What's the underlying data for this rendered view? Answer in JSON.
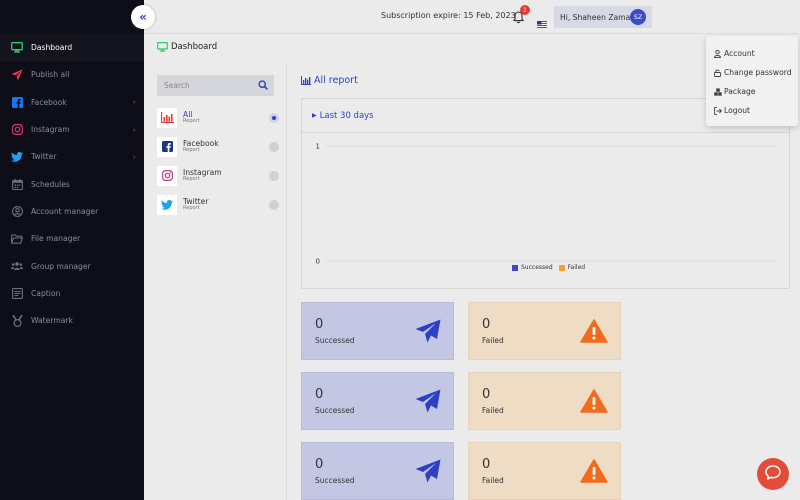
{
  "sidebar": {
    "items": [
      {
        "label": "Dashboard",
        "icon": "monitor-icon",
        "active": true
      },
      {
        "label": "Publish all",
        "icon": "paper-plane-icon"
      },
      {
        "label": "Facebook",
        "icon": "facebook-icon",
        "has_submenu": true
      },
      {
        "label": "Instagram",
        "icon": "instagram-icon",
        "has_submenu": true
      },
      {
        "label": "Twitter",
        "icon": "twitter-icon",
        "has_submenu": true
      },
      {
        "label": "Schedules",
        "icon": "calendar-icon"
      },
      {
        "label": "Account manager",
        "icon": "user-circle-icon"
      },
      {
        "label": "File manager",
        "icon": "folder-icon"
      },
      {
        "label": "Group manager",
        "icon": "users-icon"
      },
      {
        "label": "Caption",
        "icon": "caption-icon"
      },
      {
        "label": "Watermark",
        "icon": "medal-icon"
      }
    ]
  },
  "header": {
    "subscription_text": "Subscription expire: 15 Feb, 2023",
    "notification_count": "1",
    "user_greeting": "Hi, Shaheen Zaman",
    "avatar_initials": "SZ"
  },
  "user_menu": {
    "items": [
      {
        "label": "Account",
        "icon": "user-icon"
      },
      {
        "label": "Change password",
        "icon": "lock-icon"
      },
      {
        "label": "Package",
        "icon": "cubes-icon"
      },
      {
        "label": "Logout",
        "icon": "logout-icon"
      }
    ]
  },
  "page": {
    "title": "Dashboard"
  },
  "filter": {
    "search_placeholder": "Search",
    "items": [
      {
        "name": "All",
        "sub": "Report",
        "icon": "bar-chart-icon",
        "selected": true
      },
      {
        "name": "Facebook",
        "sub": "Report",
        "icon": "facebook-icon",
        "selected": false
      },
      {
        "name": "Instagram",
        "sub": "Report",
        "icon": "instagram-icon",
        "selected": false
      },
      {
        "name": "Twitter",
        "sub": "Report",
        "icon": "twitter-icon",
        "selected": false
      }
    ]
  },
  "report": {
    "title": "All report",
    "period_label": "Last 30 days"
  },
  "chart_data": {
    "type": "bar",
    "title": "",
    "xlabel": "",
    "ylabel": "",
    "ylim": [
      0,
      1
    ],
    "yticks": [
      "1",
      "0"
    ],
    "grid": true,
    "legend_position": "bottom",
    "series": [
      {
        "name": "Successed",
        "color": "#3b4cca",
        "values": []
      },
      {
        "name": "Failed",
        "color": "#f5a030",
        "values": []
      }
    ]
  },
  "stats": [
    {
      "value": "0",
      "label": "Successed"
    },
    {
      "value": "0",
      "label": "Failed"
    },
    {
      "value": "0",
      "label": "Successed"
    },
    {
      "value": "0",
      "label": "Failed"
    },
    {
      "value": "0",
      "label": "Successed"
    },
    {
      "value": "0",
      "label": "Failed"
    }
  ],
  "colors": {
    "accent": "#2d3fc7",
    "sidebar_bg": "#0e0e18",
    "success_card": "#c4c7e4",
    "failed_card": "#efdcc4",
    "warning": "#f26b1d",
    "chat": "#e34b3a"
  }
}
